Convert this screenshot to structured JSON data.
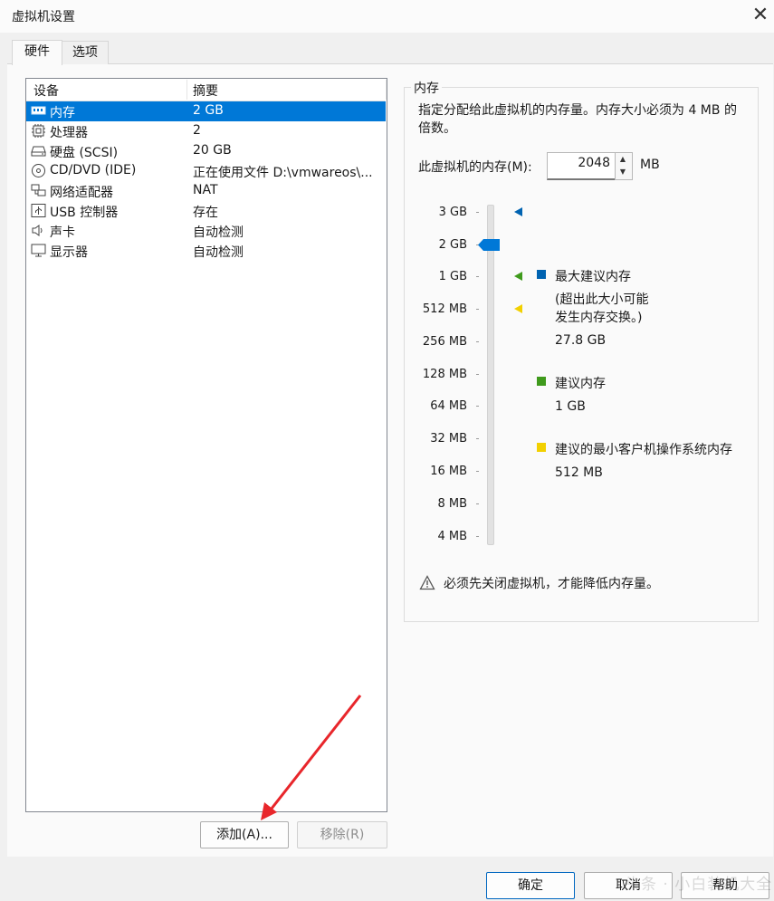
{
  "window": {
    "title": "虚拟机设置",
    "close_glyph": "✕"
  },
  "tabs": [
    {
      "label": "硬件",
      "active": true
    },
    {
      "label": "选项",
      "active": false
    }
  ],
  "device_table": {
    "headers": [
      "设备",
      "摘要"
    ],
    "rows": [
      {
        "name": "内存",
        "summary": "2 GB",
        "icon": "memory-icon",
        "selected": true
      },
      {
        "name": "处理器",
        "summary": "2",
        "icon": "cpu-icon"
      },
      {
        "name": "硬盘 (SCSI)",
        "summary": "20 GB",
        "icon": "hard-disk-icon"
      },
      {
        "name": "CD/DVD (IDE)",
        "summary": "正在使用文件 D:\\vmwareos\\...",
        "icon": "cd-dvd-icon"
      },
      {
        "name": "网络适配器",
        "summary": "NAT",
        "icon": "network-adapter-icon"
      },
      {
        "name": "USB 控制器",
        "summary": "存在",
        "icon": "usb-icon"
      },
      {
        "name": "声卡",
        "summary": "自动检测",
        "icon": "sound-icon"
      },
      {
        "name": "显示器",
        "summary": "自动检测",
        "icon": "display-icon"
      }
    ]
  },
  "buttons": {
    "add": "添加(A)...",
    "remove": "移除(R)",
    "ok": "确定",
    "cancel": "取消",
    "help": "帮助"
  },
  "memory": {
    "group_title": "内存",
    "description": "指定分配给此虚拟机的内存量。内存大小必须为 4 MB 的倍数。",
    "field_label": "此虚拟机的内存(M):",
    "value": "2048",
    "unit": "MB",
    "scale_labels": [
      "3 GB",
      "2 GB",
      "1 GB",
      "512 MB",
      "256 MB",
      "128 MB",
      "64 MB",
      "32 MB",
      "16 MB",
      "8 MB",
      "4 MB"
    ],
    "slider_value": "2 GB",
    "legend": {
      "max_title": "最大建议内存",
      "max_note": "(超出此大小可能\n发生内存交换。)",
      "max_value": "27.8 GB",
      "rec_title": "建议内存",
      "rec_value": "1 GB",
      "min_title": "建议的最小客户机操作系统内存",
      "min_value": "512 MB"
    },
    "warning": "必须先关闭虚拟机，才能降低内存量。",
    "colors": {
      "max": "#0063b1",
      "recommended": "#3f9a1c",
      "minimum": "#f2d000",
      "selection": "#0078d7"
    }
  },
  "annotation": {
    "arrow_color": "#e8262b"
  },
  "watermark": "头条 · 小白装机大全"
}
